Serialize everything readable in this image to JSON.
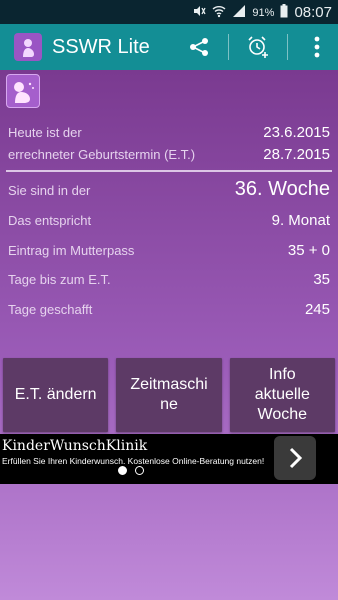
{
  "status_bar": {
    "battery": "91%",
    "time": "08:07"
  },
  "action_bar": {
    "title": "SSWR Lite"
  },
  "info": {
    "rows": [
      {
        "label": "Heute ist der",
        "value": "23.6.2015"
      },
      {
        "label": "errechneter Geburtstermin (E.T.)",
        "value": "28.7.2015"
      },
      {
        "label": "Sie sind in der",
        "value": "36. Woche"
      },
      {
        "label": "Das entspricht",
        "value": "9. Monat"
      },
      {
        "label": "Eintrag im Mutterpass",
        "value": "35 + 0"
      },
      {
        "label": "Tage bis zum E.T.",
        "value": "35"
      },
      {
        "label": "Tage geschafft",
        "value": "245"
      }
    ]
  },
  "buttons": {
    "et_change": "E.T. ändern",
    "time_machine_1": "Zeitmaschi",
    "time_machine_2": "ne",
    "info_week_1": "Info",
    "info_week_2": "aktuelle",
    "info_week_3": "Woche"
  },
  "ad": {
    "title": "KinderWunschKlinik",
    "text": "Erfüllen Sie Ihren Kinderwunsch. Kostenlose Online-Beratung nutzen!"
  }
}
